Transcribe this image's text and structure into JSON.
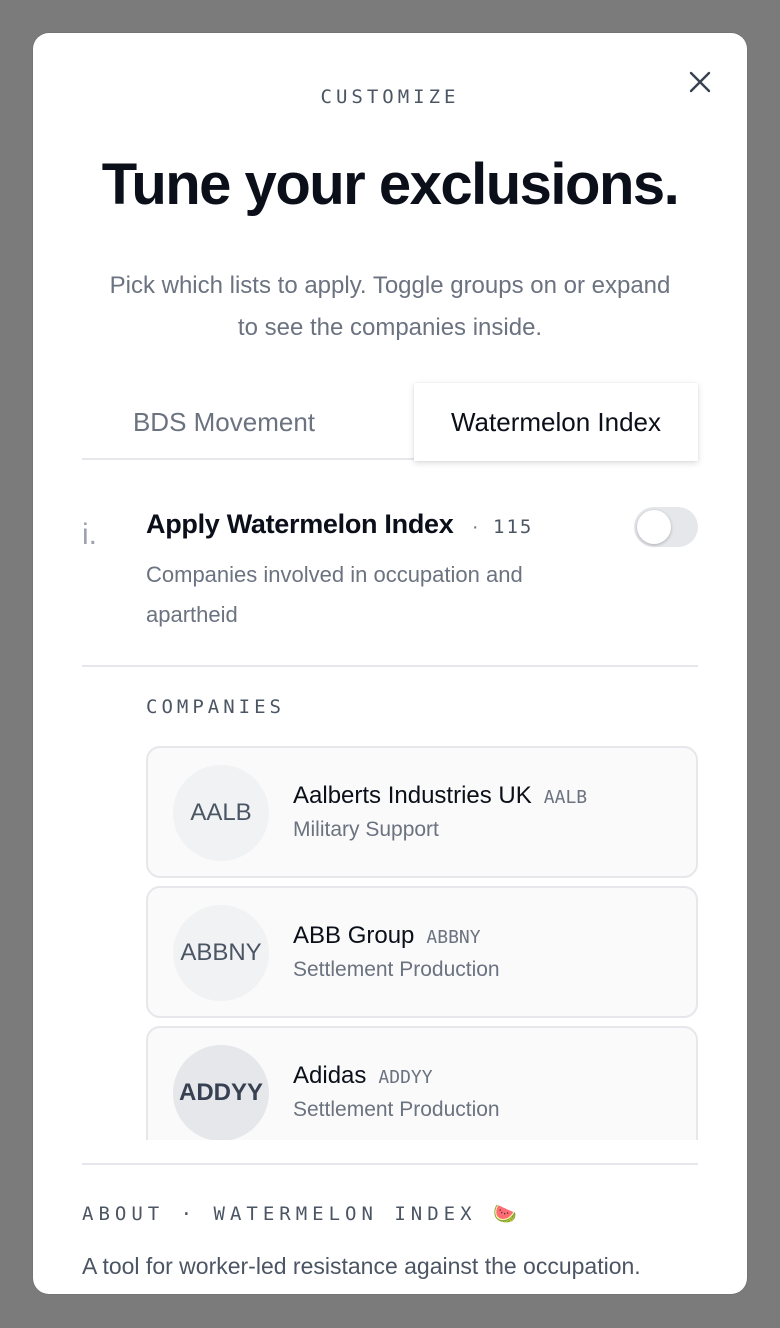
{
  "modal": {
    "eyebrow": "CUSTOMIZE",
    "title": "Tune your exclusions.",
    "subtitle": "Pick which lists to apply. Toggle groups on or expand to see the companies inside."
  },
  "tabs": [
    {
      "label": "BDS Movement",
      "active": false
    },
    {
      "label": "Watermelon Index",
      "active": true
    }
  ],
  "group": {
    "marker": "i.",
    "title": "Apply Watermelon Index",
    "separator": "·",
    "count": "115",
    "description": "Companies involved in occupation and apartheid",
    "enabled": false
  },
  "companies_label": "COMPANIES",
  "companies": [
    {
      "avatar": "AALB",
      "name": "Aalberts Industries UK",
      "ticker": "AALB",
      "category": "Military Support"
    },
    {
      "avatar": "ABBNY",
      "name": "ABB Group",
      "ticker": "ABBNY",
      "category": "Settlement Production"
    },
    {
      "avatar": "ADDYY",
      "name": "Adidas",
      "ticker": "ADDYY",
      "category": "Settlement Production"
    }
  ],
  "about": {
    "label": "ABOUT · WATERMELON INDEX",
    "emoji": "🍉",
    "text": "A tool for worker-led resistance against the occupation."
  },
  "colors": {
    "backdrop": "#7b7b7b",
    "title": "#0b0f19",
    "muted": "#6b7280",
    "border": "#e5e7eb"
  }
}
